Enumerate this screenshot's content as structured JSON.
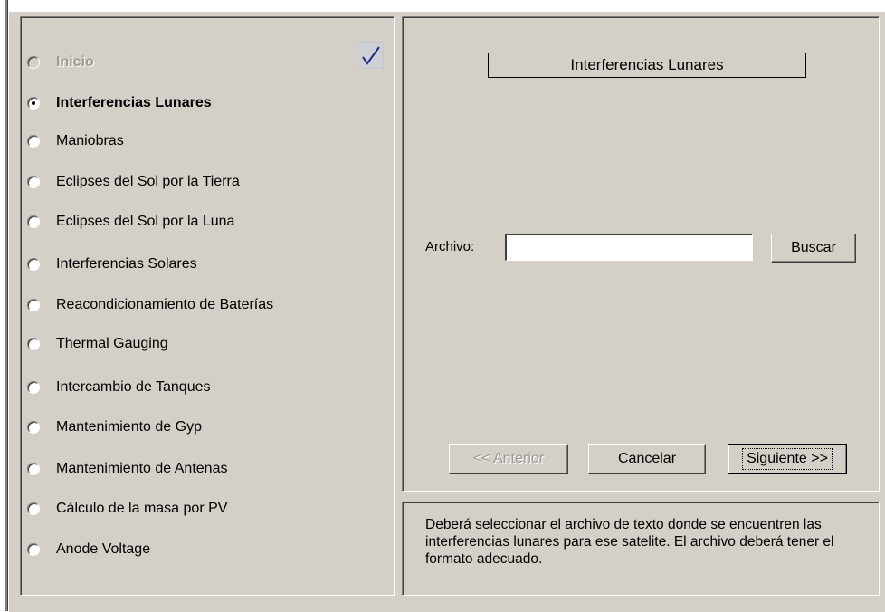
{
  "steps": [
    {
      "label": "Inicio",
      "state": "disabled"
    },
    {
      "label": "Interferencias Lunares",
      "state": "selected"
    },
    {
      "label": "Maniobras",
      "state": "normal"
    },
    {
      "label": "Eclipses del Sol por la Tierra",
      "state": "normal"
    },
    {
      "label": "Eclipses del Sol por la Luna",
      "state": "normal"
    },
    {
      "label": "Interferencias Solares",
      "state": "normal"
    },
    {
      "label": "Reacondicionamiento de Baterías",
      "state": "normal"
    },
    {
      "label": "Thermal Gauging",
      "state": "normal"
    },
    {
      "label": "Intercambio de Tanques",
      "state": "normal"
    },
    {
      "label": "Mantenimiento de Gyp",
      "state": "normal"
    },
    {
      "label": "Mantenimiento de Antenas",
      "state": "normal"
    },
    {
      "label": "Cálculo de la masa por PV",
      "state": "normal"
    },
    {
      "label": "Anode Voltage",
      "state": "normal"
    }
  ],
  "completed_icon": "checkmark-icon",
  "content": {
    "title": "Interferencias Lunares",
    "archivo_label": "Archivo:",
    "archivo_value": "",
    "buscar_label": "Buscar"
  },
  "nav": {
    "anterior_label": "<< Anterior",
    "cancelar_label": "Cancelar",
    "siguiente_label": "Siguiente >>"
  },
  "hint": {
    "text": "Deberá seleccionar el archivo de texto donde se encuentren las interferencias lunares para ese satelite. El archivo deberá tener el formato adecuado."
  },
  "colors": {
    "face": "#d4d0c8",
    "disabled_text": "#9c9a94",
    "check": "#1c2c8c"
  }
}
